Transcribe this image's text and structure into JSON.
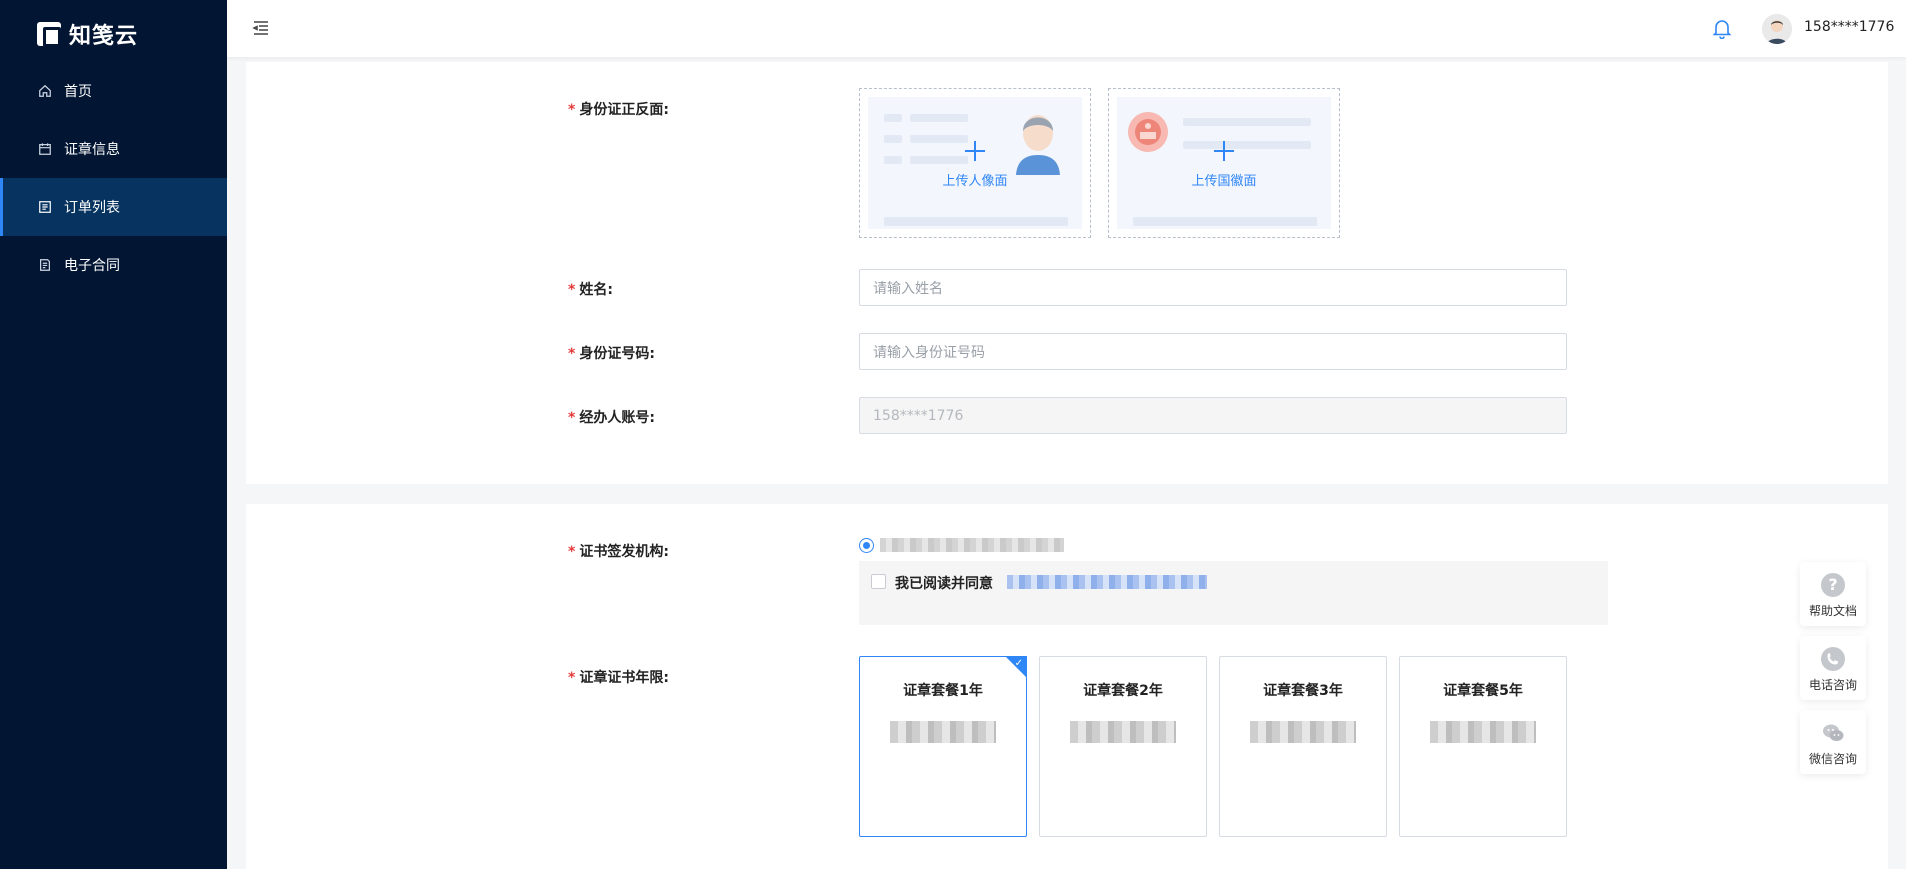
{
  "app": {
    "logo_text": "知笺云"
  },
  "sidebar": {
    "items": [
      {
        "label": "首页",
        "icon": "home-icon"
      },
      {
        "label": "证章信息",
        "icon": "calendar-icon"
      },
      {
        "label": "订单列表",
        "icon": "list-icon",
        "active": true
      },
      {
        "label": "电子合同",
        "icon": "contract-icon"
      }
    ]
  },
  "header": {
    "user_phone": "158****1776"
  },
  "form": {
    "id_card_label": "身份证正反面:",
    "upload_portrait": "上传人像面",
    "upload_emblem": "上传国徽面",
    "name_label": "姓名:",
    "name_placeholder": "请输入姓名",
    "id_number_label": "身份证号码:",
    "id_number_placeholder": "请输入身份证号码",
    "operator_label": "经办人账号:",
    "operator_value": "158****1776",
    "issuer_label": "证书签发机构:",
    "agree_text": "我已阅读并同意",
    "period_label": "证章证书年限:"
  },
  "packages": [
    {
      "name": "证章套餐1年",
      "selected": true
    },
    {
      "name": "证章套餐2年",
      "selected": false
    },
    {
      "name": "证章套餐3年",
      "selected": false
    },
    {
      "name": "证章套餐5年",
      "selected": false
    }
  ],
  "float_help": [
    {
      "label": "帮助文档",
      "icon": "question-icon"
    },
    {
      "label": "电话咨询",
      "icon": "phone-icon"
    },
    {
      "label": "微信咨询",
      "icon": "wechat-icon"
    }
  ],
  "colors": {
    "sidebar_bg": "#021533",
    "active_bg": "#06335f",
    "accent": "#2f86f6",
    "required": "#e43b3b"
  }
}
